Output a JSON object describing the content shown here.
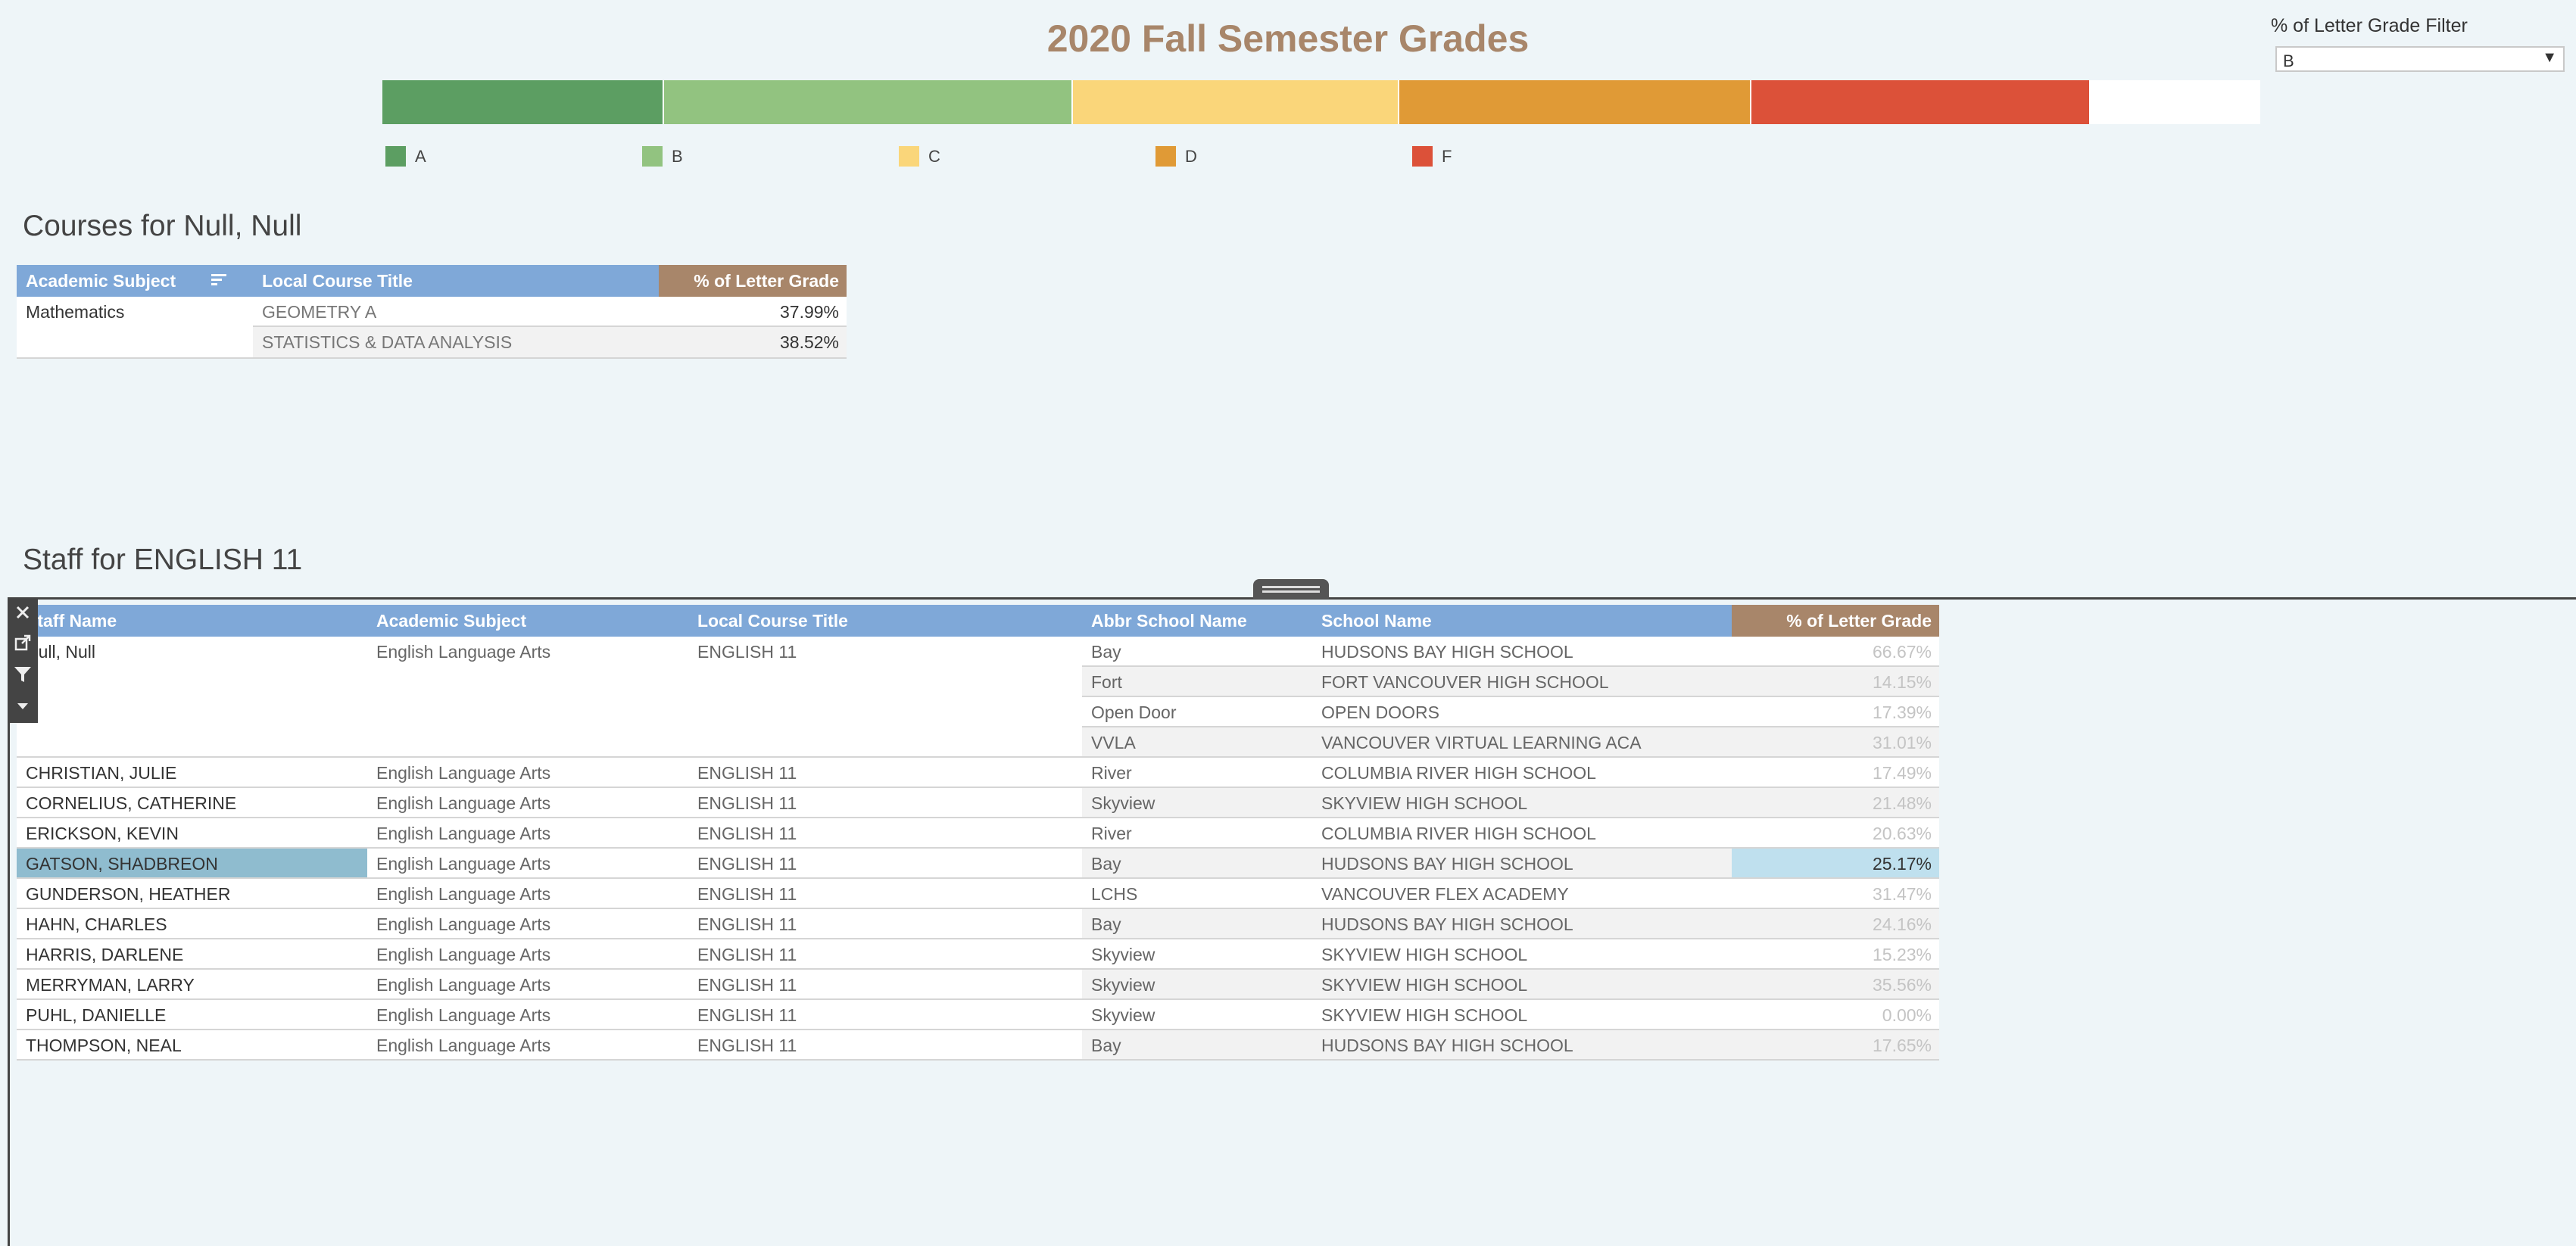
{
  "title": "2020 Fall Semester Grades",
  "filter": {
    "label": "% of Letter Grade Filter",
    "selected": "B"
  },
  "grade_bar": {
    "segments": [
      {
        "grade": "A",
        "fraction": 0.1575,
        "color": "#5c9e62"
      },
      {
        "grade": "B",
        "fraction": 0.229,
        "color": "#92c380"
      },
      {
        "grade": "C",
        "fraction": 0.1825,
        "color": "#fad67a"
      },
      {
        "grade": "D",
        "fraction": 0.197,
        "color": "#e09a36"
      },
      {
        "grade": "F",
        "fraction": 0.19,
        "color": "#dc5139"
      }
    ]
  },
  "legend": [
    {
      "label": "A",
      "color": "#5c9e62"
    },
    {
      "label": "B",
      "color": "#92c380"
    },
    {
      "label": "C",
      "color": "#fad67a"
    },
    {
      "label": "D",
      "color": "#e09a36"
    },
    {
      "label": "F",
      "color": "#dc5139"
    }
  ],
  "courses": {
    "heading": "Courses for Null, Null",
    "headers": {
      "subject": "Academic Subject",
      "title": "Local Course Title",
      "pct": "% of Letter Grade"
    },
    "subject": "Mathematics",
    "rows": [
      {
        "title": "GEOMETRY A",
        "pct": "37.99%"
      },
      {
        "title": "STATISTICS & DATA ANALYSIS",
        "pct": "38.52%"
      }
    ]
  },
  "staff": {
    "heading": "Staff for ENGLISH 11",
    "headers": {
      "name": "Staff Name",
      "subject": "Academic Subject",
      "course": "Local Course Title",
      "abbr": "Abbr School Name",
      "school": "School Name",
      "pct": "% of Letter Grade"
    },
    "rows": [
      {
        "name": "Null, Null",
        "subject": "English Language Arts",
        "course": "ENGLISH 11",
        "abbr": "Bay",
        "school": "HUDSONS BAY HIGH SCHOOL",
        "pct": "66.67%"
      },
      {
        "name": "",
        "subject": "",
        "course": "",
        "abbr": "Fort",
        "school": "FORT VANCOUVER HIGH SCHOOL",
        "pct": "14.15%"
      },
      {
        "name": "",
        "subject": "",
        "course": "",
        "abbr": "Open Door",
        "school": "OPEN DOORS",
        "pct": "17.39%"
      },
      {
        "name": "",
        "subject": "",
        "course": "",
        "abbr": "VVLA",
        "school": "VANCOUVER VIRTUAL LEARNING ACA",
        "pct": "31.01%"
      },
      {
        "name": "CHRISTIAN, JULIE",
        "subject": "English Language Arts",
        "course": "ENGLISH 11",
        "abbr": "River",
        "school": "COLUMBIA RIVER HIGH SCHOOL",
        "pct": "17.49%"
      },
      {
        "name": "CORNELIUS, CATHERINE",
        "subject": "English Language Arts",
        "course": "ENGLISH 11",
        "abbr": "Skyview",
        "school": "SKYVIEW HIGH SCHOOL",
        "pct": "21.48%"
      },
      {
        "name": "ERICKSON, KEVIN",
        "subject": "English Language Arts",
        "course": "ENGLISH 11",
        "abbr": "River",
        "school": "COLUMBIA RIVER HIGH SCHOOL",
        "pct": "20.63%"
      },
      {
        "name": "GATSON, SHADBREON",
        "subject": "English Language Arts",
        "course": "ENGLISH 11",
        "abbr": "Bay",
        "school": "HUDSONS BAY HIGH SCHOOL",
        "pct": "25.17%",
        "selected": true
      },
      {
        "name": "GUNDERSON, HEATHER",
        "subject": "English Language Arts",
        "course": "ENGLISH 11",
        "abbr": "LCHS",
        "school": "VANCOUVER FLEX ACADEMY",
        "pct": "31.47%"
      },
      {
        "name": "HAHN, CHARLES",
        "subject": "English Language Arts",
        "course": "ENGLISH 11",
        "abbr": "Bay",
        "school": "HUDSONS BAY HIGH SCHOOL",
        "pct": "24.16%"
      },
      {
        "name": "HARRIS, DARLENE",
        "subject": "English Language Arts",
        "course": "ENGLISH 11",
        "abbr": "Skyview",
        "school": "SKYVIEW HIGH SCHOOL",
        "pct": "15.23%"
      },
      {
        "name": "MERRYMAN, LARRY",
        "subject": "English Language Arts",
        "course": "ENGLISH 11",
        "abbr": "Skyview",
        "school": "SKYVIEW HIGH SCHOOL",
        "pct": "35.56%"
      },
      {
        "name": "PUHL, DANIELLE",
        "subject": "English Language Arts",
        "course": "ENGLISH 11",
        "abbr": "Skyview",
        "school": "SKYVIEW HIGH SCHOOL",
        "pct": "0.00%"
      },
      {
        "name": "THOMPSON, NEAL",
        "subject": "English Language Arts",
        "course": "ENGLISH 11",
        "abbr": "Bay",
        "school": "HUDSONS BAY HIGH SCHOOL",
        "pct": "17.65%"
      }
    ]
  },
  "icons": [
    "close-icon",
    "popout-icon",
    "filter-icon",
    "more-options-icon",
    "sort-icon",
    "dropdown-arrow-icon"
  ],
  "colors": {
    "header_blue": "#7fa8d8",
    "header_tan": "#a8866a",
    "title": "#a8866a",
    "selected_row": "#8fbccf",
    "selected_pct": "#bfe0ee"
  }
}
